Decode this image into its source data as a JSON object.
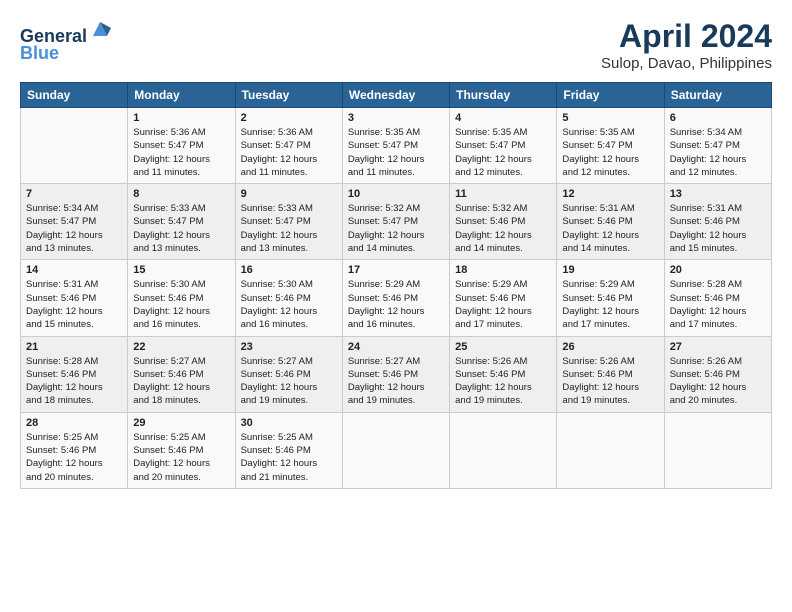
{
  "header": {
    "logo_line1": "General",
    "logo_line2": "Blue",
    "title": "April 2024",
    "subtitle": "Sulop, Davao, Philippines"
  },
  "columns": [
    "Sunday",
    "Monday",
    "Tuesday",
    "Wednesday",
    "Thursday",
    "Friday",
    "Saturday"
  ],
  "weeks": [
    [
      {
        "day": "",
        "info": ""
      },
      {
        "day": "1",
        "info": "Sunrise: 5:36 AM\nSunset: 5:47 PM\nDaylight: 12 hours\nand 11 minutes."
      },
      {
        "day": "2",
        "info": "Sunrise: 5:36 AM\nSunset: 5:47 PM\nDaylight: 12 hours\nand 11 minutes."
      },
      {
        "day": "3",
        "info": "Sunrise: 5:35 AM\nSunset: 5:47 PM\nDaylight: 12 hours\nand 11 minutes."
      },
      {
        "day": "4",
        "info": "Sunrise: 5:35 AM\nSunset: 5:47 PM\nDaylight: 12 hours\nand 12 minutes."
      },
      {
        "day": "5",
        "info": "Sunrise: 5:35 AM\nSunset: 5:47 PM\nDaylight: 12 hours\nand 12 minutes."
      },
      {
        "day": "6",
        "info": "Sunrise: 5:34 AM\nSunset: 5:47 PM\nDaylight: 12 hours\nand 12 minutes."
      }
    ],
    [
      {
        "day": "7",
        "info": "Sunrise: 5:34 AM\nSunset: 5:47 PM\nDaylight: 12 hours\nand 13 minutes."
      },
      {
        "day": "8",
        "info": "Sunrise: 5:33 AM\nSunset: 5:47 PM\nDaylight: 12 hours\nand 13 minutes."
      },
      {
        "day": "9",
        "info": "Sunrise: 5:33 AM\nSunset: 5:47 PM\nDaylight: 12 hours\nand 13 minutes."
      },
      {
        "day": "10",
        "info": "Sunrise: 5:32 AM\nSunset: 5:47 PM\nDaylight: 12 hours\nand 14 minutes."
      },
      {
        "day": "11",
        "info": "Sunrise: 5:32 AM\nSunset: 5:46 PM\nDaylight: 12 hours\nand 14 minutes."
      },
      {
        "day": "12",
        "info": "Sunrise: 5:31 AM\nSunset: 5:46 PM\nDaylight: 12 hours\nand 14 minutes."
      },
      {
        "day": "13",
        "info": "Sunrise: 5:31 AM\nSunset: 5:46 PM\nDaylight: 12 hours\nand 15 minutes."
      }
    ],
    [
      {
        "day": "14",
        "info": "Sunrise: 5:31 AM\nSunset: 5:46 PM\nDaylight: 12 hours\nand 15 minutes."
      },
      {
        "day": "15",
        "info": "Sunrise: 5:30 AM\nSunset: 5:46 PM\nDaylight: 12 hours\nand 16 minutes."
      },
      {
        "day": "16",
        "info": "Sunrise: 5:30 AM\nSunset: 5:46 PM\nDaylight: 12 hours\nand 16 minutes."
      },
      {
        "day": "17",
        "info": "Sunrise: 5:29 AM\nSunset: 5:46 PM\nDaylight: 12 hours\nand 16 minutes."
      },
      {
        "day": "18",
        "info": "Sunrise: 5:29 AM\nSunset: 5:46 PM\nDaylight: 12 hours\nand 17 minutes."
      },
      {
        "day": "19",
        "info": "Sunrise: 5:29 AM\nSunset: 5:46 PM\nDaylight: 12 hours\nand 17 minutes."
      },
      {
        "day": "20",
        "info": "Sunrise: 5:28 AM\nSunset: 5:46 PM\nDaylight: 12 hours\nand 17 minutes."
      }
    ],
    [
      {
        "day": "21",
        "info": "Sunrise: 5:28 AM\nSunset: 5:46 PM\nDaylight: 12 hours\nand 18 minutes."
      },
      {
        "day": "22",
        "info": "Sunrise: 5:27 AM\nSunset: 5:46 PM\nDaylight: 12 hours\nand 18 minutes."
      },
      {
        "day": "23",
        "info": "Sunrise: 5:27 AM\nSunset: 5:46 PM\nDaylight: 12 hours\nand 19 minutes."
      },
      {
        "day": "24",
        "info": "Sunrise: 5:27 AM\nSunset: 5:46 PM\nDaylight: 12 hours\nand 19 minutes."
      },
      {
        "day": "25",
        "info": "Sunrise: 5:26 AM\nSunset: 5:46 PM\nDaylight: 12 hours\nand 19 minutes."
      },
      {
        "day": "26",
        "info": "Sunrise: 5:26 AM\nSunset: 5:46 PM\nDaylight: 12 hours\nand 19 minutes."
      },
      {
        "day": "27",
        "info": "Sunrise: 5:26 AM\nSunset: 5:46 PM\nDaylight: 12 hours\nand 20 minutes."
      }
    ],
    [
      {
        "day": "28",
        "info": "Sunrise: 5:25 AM\nSunset: 5:46 PM\nDaylight: 12 hours\nand 20 minutes."
      },
      {
        "day": "29",
        "info": "Sunrise: 5:25 AM\nSunset: 5:46 PM\nDaylight: 12 hours\nand 20 minutes."
      },
      {
        "day": "30",
        "info": "Sunrise: 5:25 AM\nSunset: 5:46 PM\nDaylight: 12 hours\nand 21 minutes."
      },
      {
        "day": "",
        "info": ""
      },
      {
        "day": "",
        "info": ""
      },
      {
        "day": "",
        "info": ""
      },
      {
        "day": "",
        "info": ""
      }
    ]
  ]
}
